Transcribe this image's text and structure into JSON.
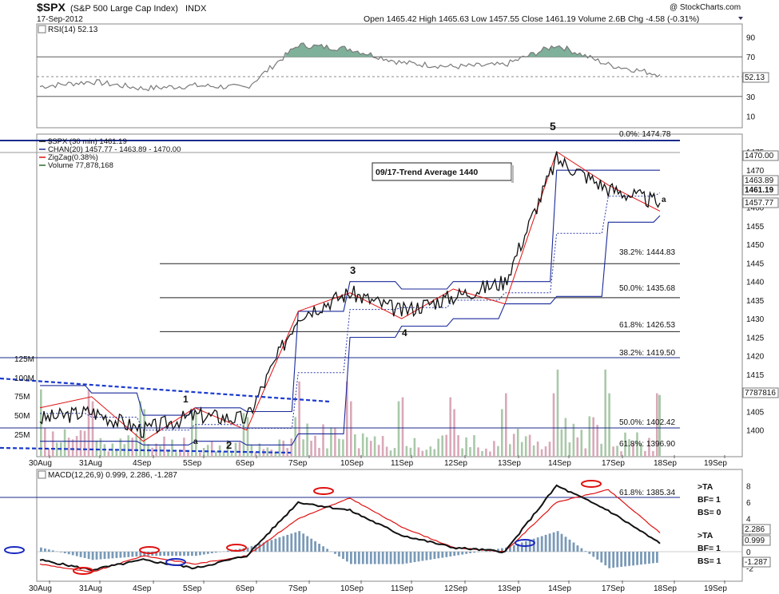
{
  "header": {
    "symbol": "$SPX",
    "name": "(S&P 500 Large Cap Index)",
    "exchange": "INDX",
    "date": "17-Sep-2012",
    "watermark": "@ StockCharts.com",
    "quote": "Open 1465.42  High 1465.63  Low 1457.55  Close 1461.19  Volume 2.6B  Chg -4.58 (-0.31%)"
  },
  "rsi_panel": {
    "label": "RSI(14) 52.13",
    "axis_ticks": [
      90,
      70,
      50,
      30,
      10
    ],
    "last_value_tag": "52.13"
  },
  "price_panel": {
    "legend": [
      {
        "text": "$SPX (30 min) 1461.19",
        "color": "#111111"
      },
      {
        "text": "CHAN(20) 1457.77 - 1463.89 - 1470.00",
        "color": "#1a2a8a"
      },
      {
        "text": "ZigZag(0.38%)",
        "color": "#e01010"
      },
      {
        "text": "Volume 77,878,168",
        "color": "#2a6a2a"
      }
    ],
    "annotation": "09/17-Trend Average 1440",
    "fib_labels": [
      "0.0%: 1474.78",
      "38.2%: 1444.83",
      "50.0%: 1435.68",
      "61.8%: 1426.53",
      "38.2%: 1419.50",
      "50.0%: 1402.42",
      "61.8%: 1396.90"
    ],
    "wave_labels": [
      "5",
      "3",
      "4",
      "1",
      "2",
      "a",
      "a"
    ],
    "price_ticks": [
      "1475",
      "1470",
      "1465",
      "1460",
      "1455",
      "1450",
      "1445",
      "1440",
      "1435",
      "1430",
      "1425",
      "1420",
      "1415",
      "1410",
      "1405",
      "1400"
    ],
    "volume_ticks": [
      "125M",
      "100M",
      "75M",
      "50M",
      "25M"
    ],
    "right_tags": [
      "1470.00",
      "1463.89",
      "1461.19",
      "1457.77",
      "7787816"
    ]
  },
  "macd_panel": {
    "label": "MACD(12,26,9) 0.999, 2.286, -1.287",
    "axis_ticks": [
      8,
      6,
      4,
      2,
      0,
      -2
    ],
    "fib_label": "61.8%: 1385.34",
    "notes_top": [
      ">TA",
      "BF= 1",
      "BS= 0"
    ],
    "notes_bottom": [
      ">TA",
      "BF= 1",
      "BS= 1"
    ],
    "right_tags": [
      "2.286",
      "0.999",
      "-1.287"
    ]
  },
  "x_axis_labels": [
    "30Aug",
    "31Aug",
    "4Sep",
    "5Sep",
    "6Sep",
    "7Sep",
    "10Sep",
    "11Sep",
    "12Sep",
    "13Sep",
    "14Sep",
    "17Sep",
    "18Sep",
    "19Sep"
  ],
  "chart_data": [
    {
      "type": "line",
      "title": "RSI(14) 52.13",
      "ylim": [
        0,
        100
      ],
      "reference_lines": [
        70,
        30
      ],
      "x": [
        "30Aug",
        "31Aug",
        "4Sep",
        "5Sep",
        "6Sep",
        "7Sep",
        "10Sep",
        "11Sep",
        "12Sep",
        "13Sep",
        "14Sep",
        "17Sep",
        "18Sep"
      ],
      "series": [
        {
          "values": [
            40,
            45,
            38,
            41,
            39,
            82,
            78,
            64,
            60,
            62,
            82,
            62,
            52.13
          ]
        }
      ]
    },
    {
      "type": "line",
      "title": "$SPX (30 min) 1461.19",
      "ylabel": "",
      "ylim": [
        1395,
        1478
      ],
      "x": [
        "30Aug",
        "31Aug",
        "4Sep",
        "5Sep",
        "6Sep",
        "7Sep",
        "10Sep",
        "11Sep",
        "12Sep",
        "13Sep",
        "14Sep",
        "17Sep",
        "18Sep"
      ],
      "series": [
        {
          "name": "$SPX (30 min) 1461.19",
          "values": [
            1403,
            1405,
            1400,
            1404,
            1403,
            1431,
            1437,
            1432,
            1436,
            1440,
            1473,
            1465,
            1461.19
          ]
        },
        {
          "name": "ZigZag(0.38%)",
          "values": [
            1406,
            1409,
            1397,
            1406,
            1400,
            1432,
            1437,
            1430,
            1438,
            1434,
            1475,
            1466,
            1459
          ]
        }
      ],
      "fib_levels": [
        1474.78,
        1444.83,
        1435.68,
        1426.53,
        1419.5,
        1402.42,
        1396.9
      ]
    },
    {
      "type": "bar",
      "title": "Volume 77,878,168",
      "ylim": [
        0,
        125
      ],
      "categories": [
        "30Aug",
        "31Aug",
        "4Sep",
        "5Sep",
        "6Sep",
        "7Sep",
        "10Sep",
        "11Sep",
        "12Sep",
        "13Sep",
        "14Sep",
        "17Sep",
        "18Sep"
      ],
      "values": [
        85,
        70,
        60,
        55,
        50,
        95,
        70,
        75,
        60,
        80,
        110,
        80,
        77.9
      ]
    },
    {
      "type": "line",
      "title": "MACD(12,26,9) 0.999, 2.286, -1.287",
      "ylim": [
        -3,
        9
      ],
      "x": [
        "30Aug",
        "31Aug",
        "4Sep",
        "5Sep",
        "6Sep",
        "7Sep",
        "10Sep",
        "11Sep",
        "12Sep",
        "13Sep",
        "14Sep",
        "17Sep",
        "18Sep"
      ],
      "series": [
        {
          "name": "MACD",
          "values": [
            -1.0,
            -2.2,
            -1.0,
            -2.0,
            -0.5,
            6.0,
            5.0,
            2.0,
            0.5,
            0.0,
            8.0,
            5.0,
            0.999
          ]
        },
        {
          "name": "Signal",
          "values": [
            -1.5,
            -2.5,
            -0.5,
            -1.5,
            -0.5,
            4.0,
            6.5,
            3.0,
            0.5,
            0.0,
            6.0,
            7.5,
            2.286
          ]
        }
      ],
      "histogram": [
        0.5,
        -1.0,
        -0.5,
        -0.5,
        0.5,
        2.5,
        -1.5,
        -1.5,
        -0.5,
        0.5,
        2.5,
        -2.0,
        -1.287
      ]
    }
  ]
}
